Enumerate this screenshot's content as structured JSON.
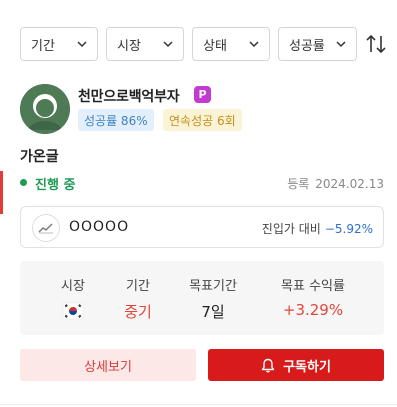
{
  "filters": [
    {
      "label": "기간"
    },
    {
      "label": "시장"
    },
    {
      "label": "상태"
    },
    {
      "label": "성공률"
    }
  ],
  "profile": {
    "name": "천만으로백억부자",
    "badge": "P",
    "success_rate": "성공률 86%",
    "streak": "연속성공 6회"
  },
  "post": {
    "title": "가온글",
    "status": "진행 중",
    "registered_label": "등록",
    "registered_date": "2024.02.13"
  },
  "stock": {
    "name": "OOOOO",
    "entry_label": "진입가 대비",
    "entry_change": "−5.92%"
  },
  "info": {
    "market_label": "시장",
    "period_label": "기간",
    "period_value": "중기",
    "target_period_label": "목표기간",
    "target_period_value": "7일",
    "target_return_label": "목표 수익률",
    "target_return_value": "+3.29%"
  },
  "buttons": {
    "detail": "상세보기",
    "subscribe": "구독하기"
  },
  "colors": {
    "accent": "#d71a1a",
    "status_green": "#1e9a55",
    "change_blue": "#2d6fd3",
    "success_tag": "#3f82c4",
    "streak_tag": "#c48f1c"
  },
  "icons": {
    "sort": "sort-arrows-icon",
    "chart": "line-chart-icon",
    "bell": "bell-icon",
    "flag": "korea-flag-icon"
  }
}
